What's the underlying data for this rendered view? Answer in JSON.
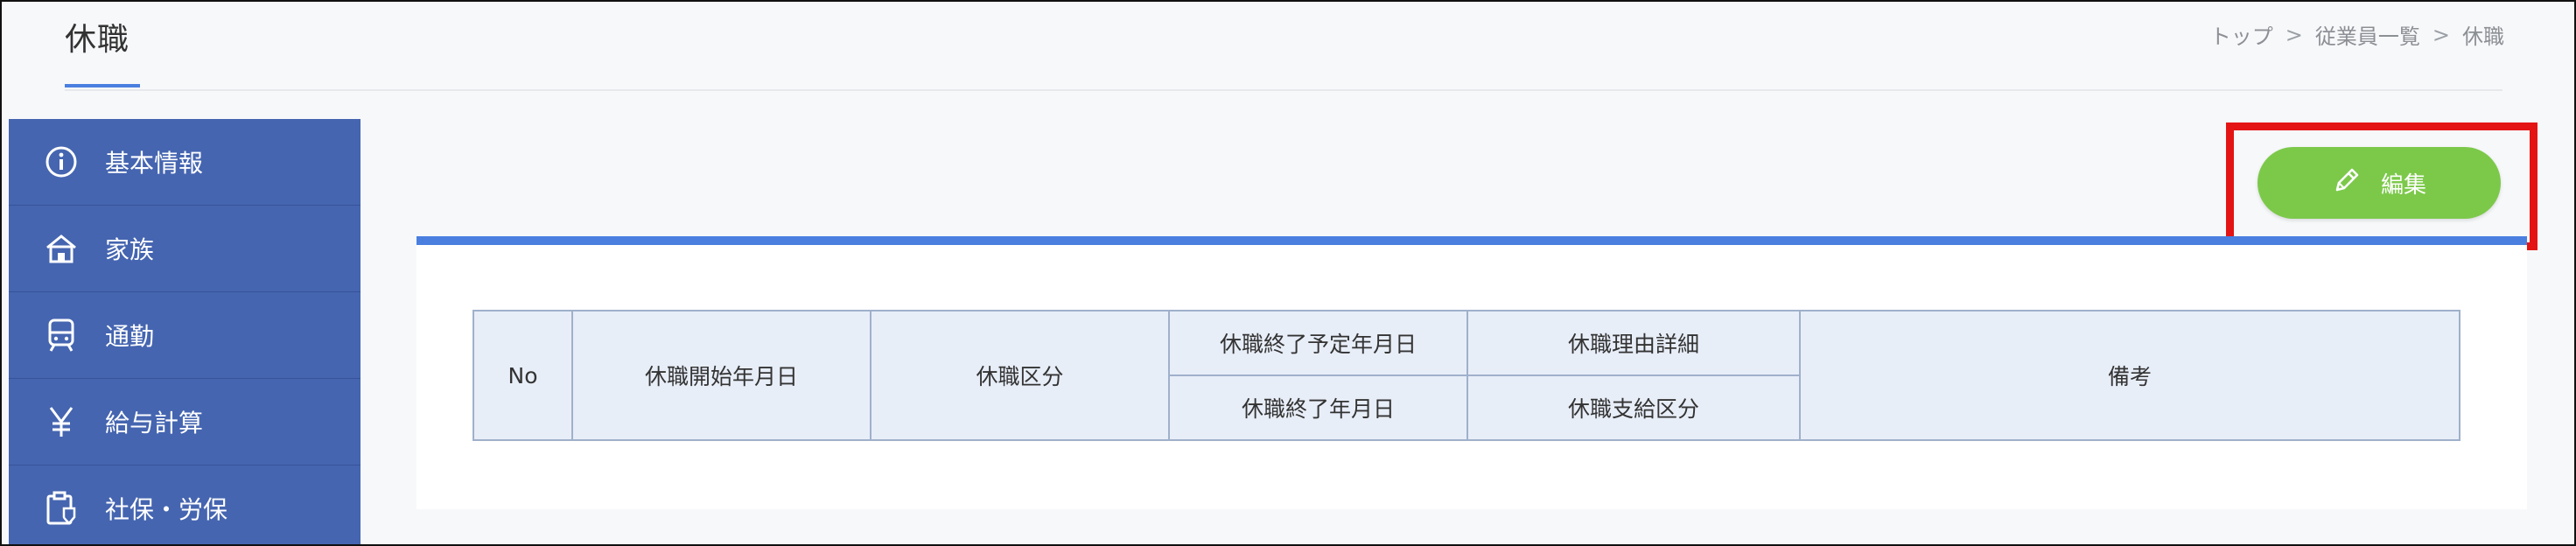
{
  "page": {
    "title": "休職"
  },
  "breadcrumb": {
    "items": [
      "トップ",
      "従業員一覧",
      "休職"
    ],
    "separator": ">"
  },
  "sidebar": {
    "items": [
      {
        "label": "基本情報",
        "icon": "info-icon"
      },
      {
        "label": "家族",
        "icon": "house-icon"
      },
      {
        "label": "通勤",
        "icon": "train-icon"
      },
      {
        "label": "給与計算",
        "icon": "yen-icon"
      },
      {
        "label": "社保・労保",
        "icon": "clipboard-shield-icon"
      }
    ]
  },
  "toolbar": {
    "edit_label": "編集",
    "edit_icon": "pencil-icon"
  },
  "table": {
    "headers": {
      "no": "No",
      "start_date": "休職開始年月日",
      "category": "休職区分",
      "planned_end_date": "休職終了予定年月日",
      "reason_detail": "休職理由詳細",
      "end_date": "休職終了年月日",
      "payment_category": "休職支給区分",
      "notes": "備考"
    },
    "rows": []
  },
  "colors": {
    "sidebar_bg": "#4565b0",
    "accent": "#4a7fe0",
    "edit_button": "#7cc94a",
    "highlight": "#e41414",
    "table_header_bg": "#e8eef8"
  }
}
